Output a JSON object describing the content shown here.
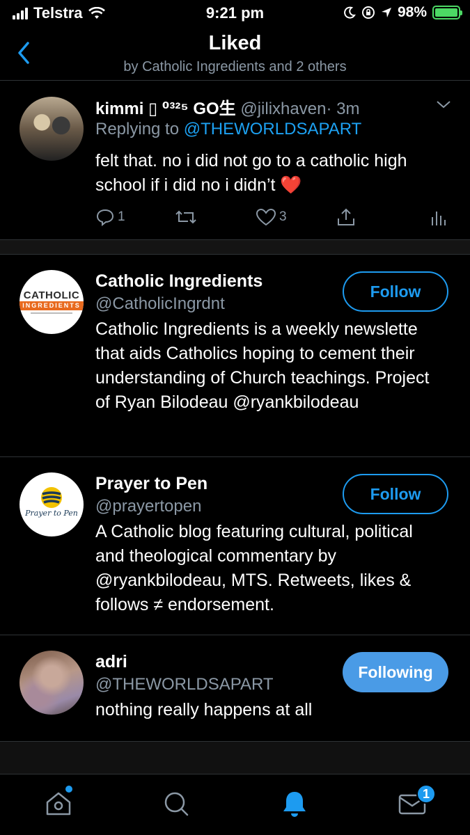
{
  "status_bar": {
    "carrier": "Telstra",
    "time": "9:21 pm",
    "battery": "98%",
    "battery_level": 0.98
  },
  "header": {
    "title": "Liked",
    "subtitle": "by Catholic Ingredients and 2 others"
  },
  "tweet": {
    "name": "kimmi ▯ ⁰³²⁵ GO生",
    "handle": "@jilixhaven",
    "time": "· 3m",
    "replying_prefix": "Replying to",
    "replying_to": "@THEWORLDSAPART",
    "text": "felt that. no i did not go to a catholic high school if i did no i didn’t ❤️",
    "reply_count": "1",
    "like_count": "3"
  },
  "users": [
    {
      "name": "Catholic Ingredients",
      "handle": "@CatholicIngrdnt",
      "bio": "Catholic Ingredients is a weekly newslette that aids Catholics hoping to cement their understanding of Church teachings. Project of Ryan Bilodeau @ryankbilodeau",
      "button": "Follow",
      "avatar_logo_line1": "CATHOLIC",
      "avatar_logo_line2": "INGREDIENTS"
    },
    {
      "name": "Prayer to Pen",
      "handle": "@prayertopen",
      "bio": "A Catholic blog featuring cultural, political and theological commentary by @ryankbilodeau, MTS. Retweets, likes & follows ≠ endorsement.",
      "button": "Follow",
      "avatar_logo_text": "Prayer to Pen"
    },
    {
      "name": "adri",
      "handle": "@THEWORLDSAPART",
      "bio": "nothing really happens at all",
      "button": "Following"
    }
  ],
  "tab_bar": {
    "messages_badge": "1",
    "active_tab": "notifications"
  },
  "colors": {
    "accent": "#1d9bf0",
    "following_bg": "#4a9be6",
    "secondary_text": "#8b98a5",
    "heart": "#e0245e"
  }
}
